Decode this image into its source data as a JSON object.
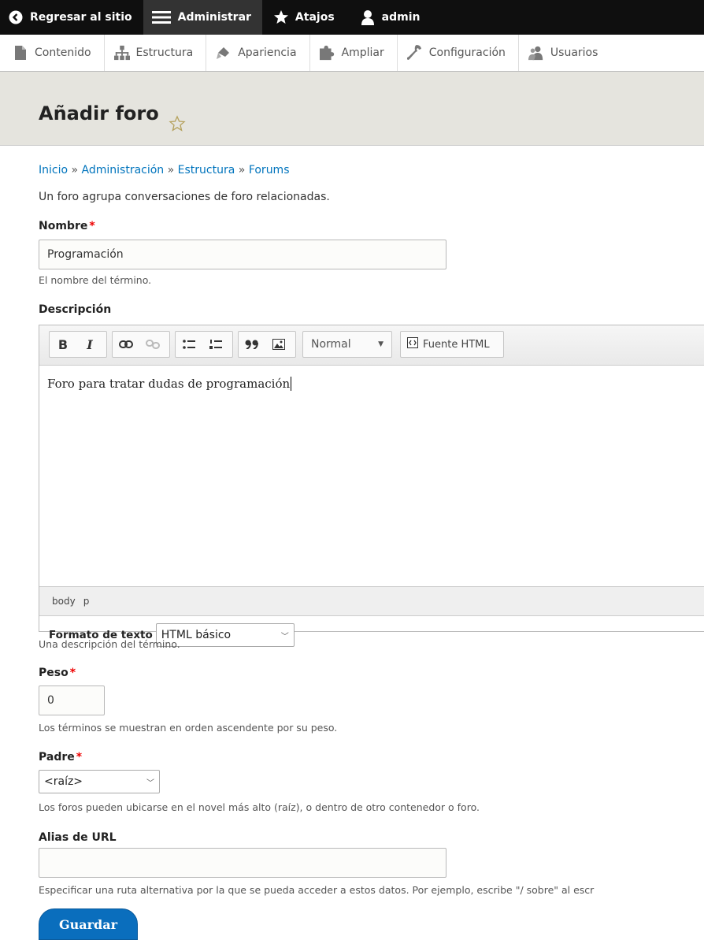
{
  "toolbar": {
    "back": "Regresar al sitio",
    "manage": "Administrar",
    "shortcuts": "Atajos",
    "user": "admin"
  },
  "tray": {
    "content": "Contenido",
    "structure": "Estructura",
    "appearance": "Apariencia",
    "extend": "Ampliar",
    "config": "Configuración",
    "people": "Usuarios"
  },
  "page": {
    "title": "Añadir foro"
  },
  "breadcrumb": {
    "items": [
      "Inicio",
      "Administración",
      "Estructura",
      "Forums"
    ],
    "separator": "»"
  },
  "intro": "Un foro agrupa conversaciones de foro relacionadas.",
  "name": {
    "label": "Nombre",
    "required": "*",
    "value": "Programación",
    "description": "El nombre del término."
  },
  "description": {
    "label": "Descripción",
    "editor": {
      "bold": "B",
      "italic": "I",
      "format": "Normal",
      "source": "Fuente HTML",
      "text": "Foro para tratar dudas de programación",
      "path_body": "body",
      "path_p": "p",
      "text_format_label": "Formato de texto",
      "text_format_value": "HTML básico"
    },
    "help": "Una descripción del término."
  },
  "weight": {
    "label": "Peso",
    "required": "*",
    "value": "0",
    "description": "Los términos se muestran en orden ascendente por su peso."
  },
  "parent": {
    "label": "Padre",
    "required": "*",
    "value": "<raíz>",
    "description": "Los foros pueden ubicarse en el novel más alto (raíz), o dentro de otro contenedor o foro."
  },
  "url_alias": {
    "label": "Alias de URL",
    "value": "",
    "description": "Especificar una ruta alternativa por la que se pueda acceder a estos datos. Por ejemplo, escribe \"/ sobre\" al escr"
  },
  "actions": {
    "save": "Guardar"
  },
  "colors": {
    "accent": "#0074bd",
    "button": "#0a6ebd",
    "required": "#e00000"
  }
}
